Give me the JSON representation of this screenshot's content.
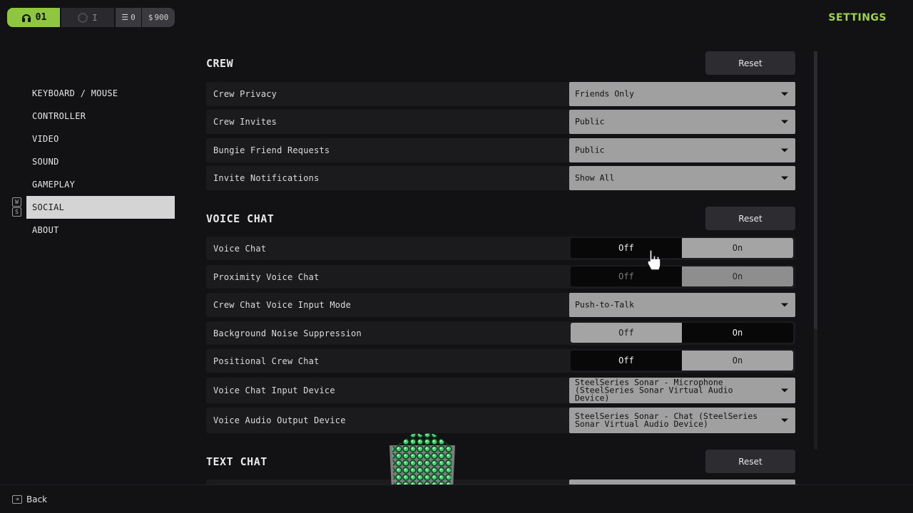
{
  "topbar": {
    "rank_label": "01",
    "second_label": "I",
    "third_label": "0",
    "fourth_label": "900",
    "accent": "#8ec63f"
  },
  "header": {
    "title": "SETTINGS"
  },
  "nav": {
    "items": [
      {
        "label": "KEYBOARD / MOUSE"
      },
      {
        "label": "CONTROLLER"
      },
      {
        "label": "VIDEO"
      },
      {
        "label": "SOUND"
      },
      {
        "label": "GAMEPLAY"
      },
      {
        "label": "SOCIAL",
        "active": true
      },
      {
        "label": "ABOUT"
      }
    ],
    "keys": [
      "W",
      "S"
    ]
  },
  "sections": {
    "crew": {
      "title": "CREW",
      "reset": "Reset",
      "rows": [
        {
          "label": "Crew Privacy",
          "value": "Friends Only"
        },
        {
          "label": "Crew Invites",
          "value": "Public"
        },
        {
          "label": "Bungie Friend Requests",
          "value": "Public"
        },
        {
          "label": "Invite Notifications",
          "value": "Show All"
        }
      ]
    },
    "voice": {
      "title": "VOICE CHAT",
      "reset": "Reset",
      "rows": [
        {
          "label": "Voice Chat",
          "off": "Off",
          "on": "On",
          "selected": "Off"
        },
        {
          "label": "Proximity Voice Chat",
          "off": "Off",
          "on": "On",
          "selected": "Off",
          "disabled": true
        },
        {
          "label": "Crew Chat Voice Input Mode",
          "value": "Push-to-Talk"
        },
        {
          "label": "Background Noise Suppression",
          "off": "Off",
          "on": "On",
          "selected": "On"
        },
        {
          "label": "Positional Crew Chat",
          "off": "Off",
          "on": "On",
          "selected": "Off"
        },
        {
          "label": "Voice Chat Input Device",
          "value": "SteelSeries Sonar - Microphone (SteelSeries Sonar Virtual Audio Device)"
        },
        {
          "label": "Voice Audio Output Device",
          "value": "SteelSeries Sonar - Chat (SteelSeries Sonar Virtual Audio Device)"
        }
      ]
    },
    "text": {
      "title": "TEXT CHAT",
      "reset": "Reset"
    }
  },
  "footer": {
    "back_label": "Back"
  }
}
